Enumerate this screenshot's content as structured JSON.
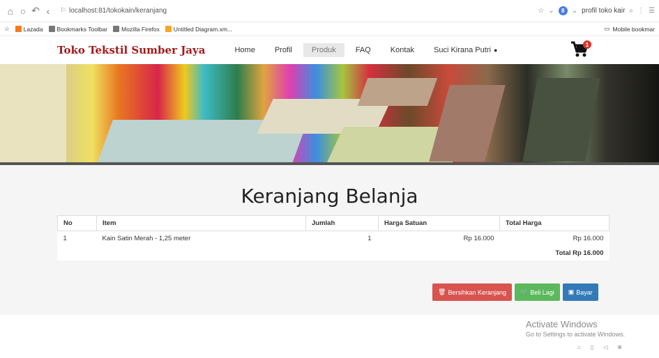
{
  "browser": {
    "url": "localhost:81/tokokain/keranjang",
    "search_text": "profil toko kair",
    "search_badge": "8"
  },
  "bookmarks": [
    {
      "label": "Lazada",
      "color": "#f47a20"
    },
    {
      "label": "Bookmarks Toolbar",
      "color": "#777777"
    },
    {
      "label": "Mozilla Firefox",
      "color": "#777777"
    },
    {
      "label": "Untitled Diagram.xm...",
      "color": "#f5a623"
    }
  ],
  "bookmarks_right": "Mobile bookmar",
  "nav": {
    "brand": "Toko Tekstil Sumber Jaya",
    "links": [
      "Home",
      "Profil",
      "Produk",
      "FAQ",
      "Kontak"
    ],
    "active": "Produk",
    "user": "Suci Kirana Putri",
    "cart_count": "1"
  },
  "page_title": "Keranjang Belanja",
  "table": {
    "headers": [
      "No",
      "Item",
      "Jumlah",
      "Harga Satuan",
      "Total Harga"
    ],
    "rows": [
      {
        "no": "1",
        "item": "Kain Satin Merah - 1,25 meter",
        "jumlah": "1",
        "harga": "Rp 16.000",
        "total": "Rp 16.000"
      }
    ],
    "grand_total": "Total Rp 16.000"
  },
  "buttons": {
    "clear": "Bersihkan Keranjang",
    "buy_more": "Beli Lagi",
    "pay": "Bayar"
  },
  "colors": {
    "brand": "#a31a1a",
    "danger": "#d9534f",
    "success": "#5cb85c",
    "primary": "#337ab7"
  },
  "windows": {
    "activate_title": "Activate Windows",
    "activate_sub": "Go to Settings to activate Windows."
  }
}
